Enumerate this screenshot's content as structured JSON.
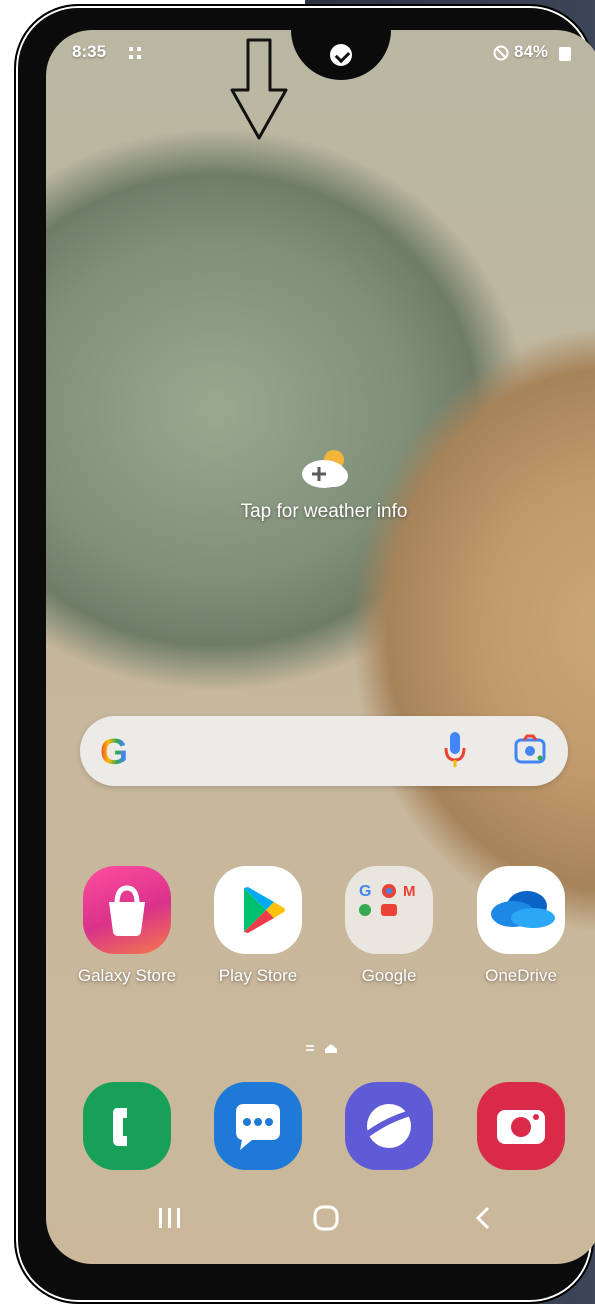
{
  "status_bar": {
    "time": "8:35",
    "notification_icon": "grid-icon",
    "mute_icon": "do-not-disturb-icon",
    "battery": "84%"
  },
  "weather_widget": {
    "label": "Tap for weather info",
    "icon": "weather-add-icon"
  },
  "search_bar": {
    "logo": "G",
    "icons": [
      "microphone-icon",
      "lens-icon"
    ]
  },
  "apps": [
    {
      "label": "Galaxy Store",
      "icon": "shopping-bag-icon"
    },
    {
      "label": "Play Store",
      "icon": "play-store-icon"
    },
    {
      "label": "Google",
      "icon": "folder-icon"
    },
    {
      "label": "OneDrive",
      "icon": "cloud-icon"
    }
  ],
  "dock": [
    {
      "icon": "phone-icon"
    },
    {
      "icon": "messages-icon"
    },
    {
      "icon": "internet-icon"
    },
    {
      "icon": "camera-icon"
    }
  ],
  "nav_bar": {
    "recent": "recent-apps-icon",
    "home": "home-icon",
    "back": "back-icon"
  },
  "colors": {
    "galaxy_store": "#e0408f",
    "play_store_bg": "#ffffff",
    "onedrive": "#1e7ad6",
    "phone": "#16a058",
    "messages": "#1e7ad6",
    "internet": "#5f5bd6",
    "camera": "#d92a4a"
  }
}
